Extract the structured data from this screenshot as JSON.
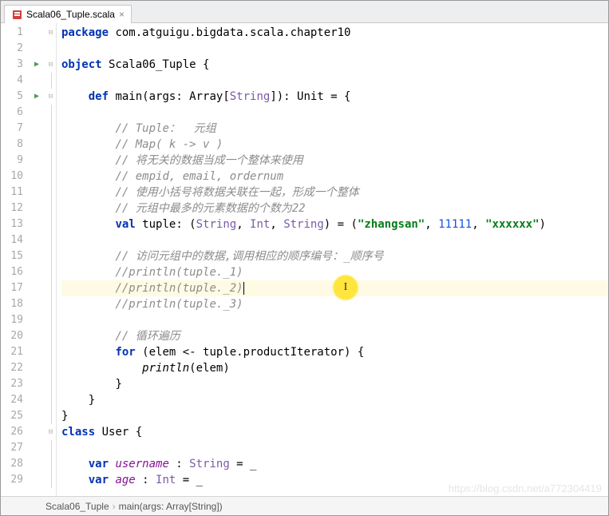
{
  "tab": {
    "filename": "Scala06_Tuple.scala"
  },
  "lines": {
    "n": [
      "1",
      "2",
      "3",
      "4",
      "5",
      "6",
      "7",
      "8",
      "9",
      "10",
      "11",
      "12",
      "13",
      "14",
      "15",
      "16",
      "17",
      "18",
      "19",
      "20",
      "21",
      "22",
      "23",
      "24",
      "25",
      "26",
      "27",
      "28",
      "29"
    ]
  },
  "code": {
    "l1_pkg": "package",
    "l1_name": " com.atguigu.bigdata.scala.chapter10",
    "l3_obj": "object",
    "l3_name": " Scala06_Tuple {",
    "l5_def": "def",
    "l5_main": " main",
    "l5_args": "(args: Array[",
    "l5_str": "String",
    "l5_rest": "]): Unit = {",
    "l7": "// Tuple：  元组",
    "l8": "// Map( k -> v )",
    "l9": "// 将无关的数据当成一个整体来使用",
    "l10": "// empid, email, ordernum",
    "l11": "// 使用小括号将数据关联在一起，形成一个整体",
    "l12": "// 元组中最多的元素数据的个数为22",
    "l13_val": "val",
    "l13_name": " tuple",
    "l13_colon": ": (",
    "l13_t1": "String",
    "l13_c1": ", ",
    "l13_t2": "Int",
    "l13_c2": ", ",
    "l13_t3": "String",
    "l13_paren": ") = (",
    "l13_s1": "\"zhangsan\"",
    "l13_c3": ", ",
    "l13_n1": "11111",
    "l13_c4": ", ",
    "l13_s2": "\"xxxxxx\"",
    "l13_end": ")",
    "l15": "// 访问元组中的数据,调用相应的顺序编号：_顺序号",
    "l16": "//println(tuple._1)",
    "l17": "//println(tuple._2)",
    "l18": "//println(tuple._3)",
    "l20": "// 循环遍历",
    "l21_for": "for",
    "l21_open": " (elem <- tuple.productIterator) {",
    "l22_pln": "println",
    "l22_arg": "(elem)",
    "l23": "}",
    "l24": "}",
    "l25": "}",
    "l26_cls": "class",
    "l26_name": " User {",
    "l28_var": "var",
    "l28_nm": " username",
    "l28_rest": " : ",
    "l28_typ": "String",
    "l28_init": " = _",
    "l29_var": "var",
    "l29_nm": " age",
    "l29_rest": " : ",
    "l29_typ": "Int",
    "l29_init": " = _"
  },
  "breadcrumb": {
    "item1": "Scala06_Tuple",
    "item2": "main(args: Array[String])"
  },
  "watermark": "https://blog.csdn.net/a772304419"
}
